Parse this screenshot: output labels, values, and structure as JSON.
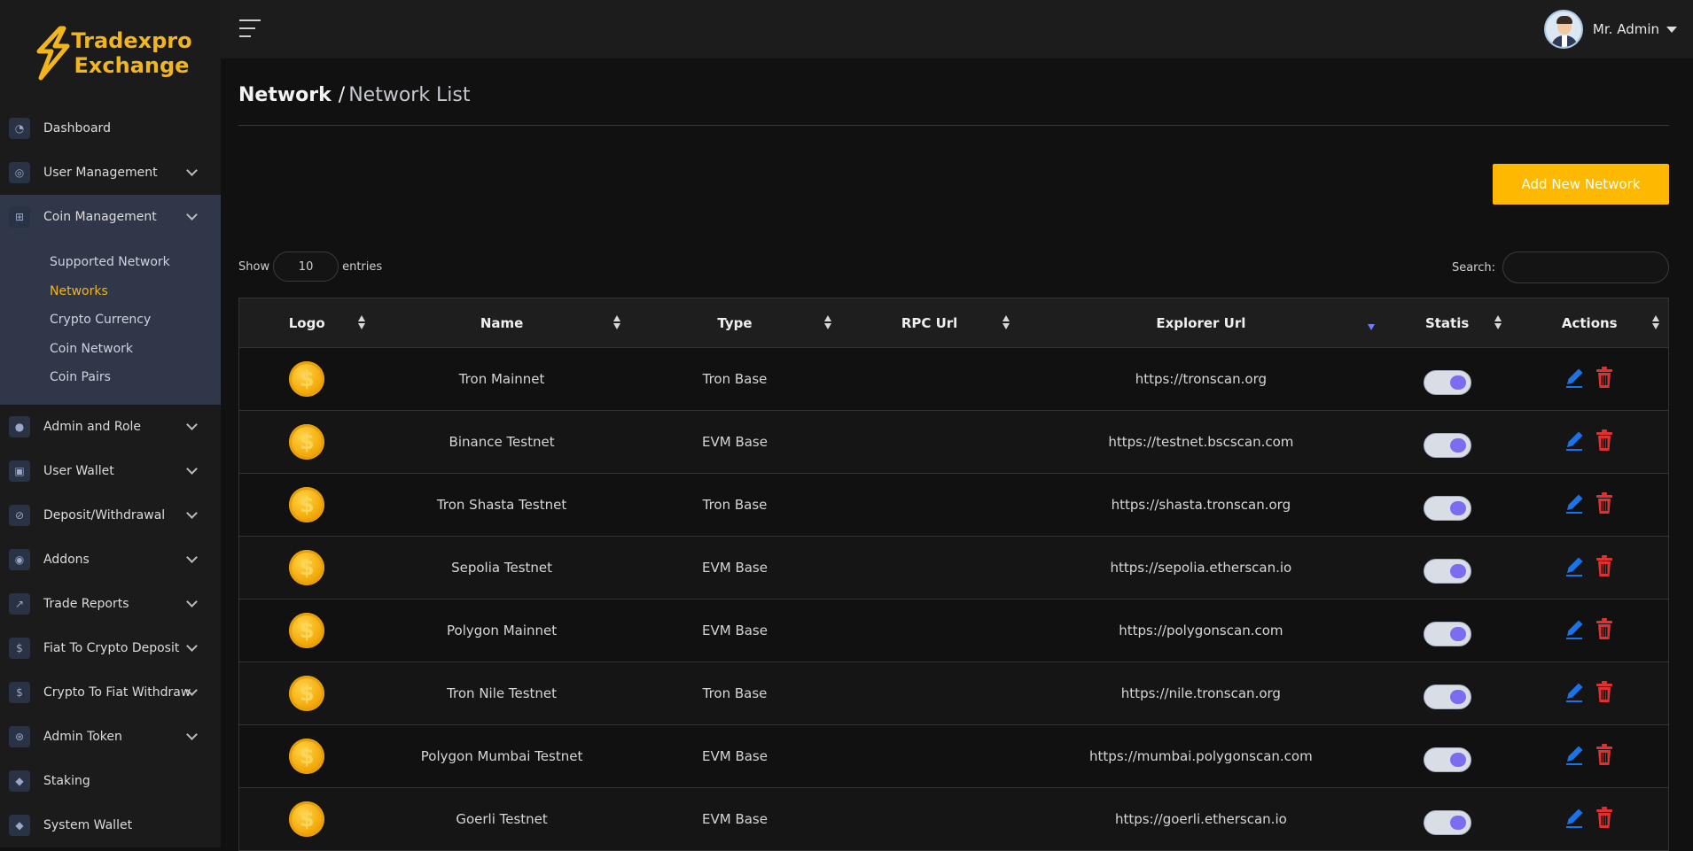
{
  "brand": {
    "line1": "Tradexpro",
    "line2": "Exchange"
  },
  "topbar": {
    "user_name": "Mr. Admin"
  },
  "sidebar": {
    "items": [
      {
        "label": "Dashboard",
        "icon": "gauge-icon",
        "has_children": false
      },
      {
        "label": "User Management",
        "icon": "user-circle-icon",
        "has_children": true
      },
      {
        "label": "Coin Management",
        "icon": "coins-icon",
        "has_children": true,
        "open": true
      },
      {
        "label": "Admin and Role",
        "icon": "user-icon",
        "has_children": true
      },
      {
        "label": "User Wallet",
        "icon": "wallet-icon",
        "has_children": true
      },
      {
        "label": "Deposit/Withdrawal",
        "icon": "exchange-icon",
        "has_children": true
      },
      {
        "label": "Addons",
        "icon": "bolt-icon",
        "has_children": true
      },
      {
        "label": "Trade Reports",
        "icon": "chart-icon",
        "has_children": true
      },
      {
        "label": "Fiat To Crypto Deposit",
        "icon": "dollar-icon",
        "has_children": true
      },
      {
        "label": "Crypto To Fiat Withdraw",
        "icon": "dollar-coin-icon",
        "has_children": true
      },
      {
        "label": "Admin Token",
        "icon": "token-icon",
        "has_children": true
      },
      {
        "label": "Staking",
        "icon": "layers-icon",
        "has_children": false
      },
      {
        "label": "System Wallet",
        "icon": "layers-icon",
        "has_children": false
      }
    ],
    "submenu": [
      "Supported Network",
      "Networks",
      "Crypto Currency",
      "Coin Network",
      "Coin Pairs"
    ],
    "active_submenu": "Networks"
  },
  "breadcrumb": {
    "root": "Network",
    "separator": "/",
    "current": "Network List"
  },
  "toolbar": {
    "add_label": "Add New Network"
  },
  "controls": {
    "show_label": "Show",
    "entries_value": "10",
    "entries_label": "entries",
    "search_label": "Search:",
    "search_value": ""
  },
  "table": {
    "columns": [
      "Logo",
      "Name",
      "Type",
      "RPC Url",
      "Explorer Url",
      "Statis",
      "Actions"
    ],
    "sorted_column": "Explorer Url",
    "rows": [
      {
        "name": "Tron Mainnet",
        "type": "Tron Base",
        "rpc_url": "",
        "explorer_url": "https://tronscan.org",
        "status": true
      },
      {
        "name": "Binance Testnet",
        "type": "EVM Base",
        "rpc_url": "",
        "explorer_url": "https://testnet.bscscan.com",
        "status": true
      },
      {
        "name": "Tron Shasta Testnet",
        "type": "Tron Base",
        "rpc_url": "",
        "explorer_url": "https://shasta.tronscan.org",
        "status": true
      },
      {
        "name": "Sepolia Testnet",
        "type": "EVM Base",
        "rpc_url": "",
        "explorer_url": "https://sepolia.etherscan.io",
        "status": true
      },
      {
        "name": "Polygon Mainnet",
        "type": "EVM Base",
        "rpc_url": "",
        "explorer_url": "https://polygonscan.com",
        "status": true
      },
      {
        "name": "Tron Nile Testnet",
        "type": "Tron Base",
        "rpc_url": "",
        "explorer_url": "https://nile.tronscan.org",
        "status": true
      },
      {
        "name": "Polygon Mumbai Testnet",
        "type": "EVM Base",
        "rpc_url": "",
        "explorer_url": "https://mumbai.polygonscan.com",
        "status": true
      },
      {
        "name": "Goerli Testnet",
        "type": "EVM Base",
        "rpc_url": "",
        "explorer_url": "https://goerli.etherscan.io",
        "status": true
      }
    ]
  },
  "colors": {
    "accent": "#fcb900",
    "edit": "#1a73e8",
    "delete": "#e03131",
    "toggle_knob": "#7b6cf0"
  }
}
